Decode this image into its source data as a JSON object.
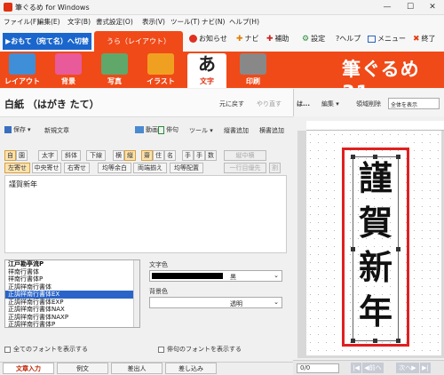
{
  "window": {
    "title": "筆ぐるめ for Windows"
  },
  "menubar": [
    "ファイル(F)",
    "編集(E)",
    "文字(B)",
    "書式設定(O)",
    "表示(V)",
    "ツール(T)",
    "ナビ(N)",
    "ヘルプ(H)"
  ],
  "tabs": {
    "front": "▶おもて（宛て名）へ切替",
    "back": "うら（レイアウト）"
  },
  "top_links": {
    "notice": "お知らせ",
    "navi": "ナビ",
    "assist": "補助",
    "settings": "設定",
    "help": "?ヘルプ",
    "menu": "メニュー",
    "exit": "終了"
  },
  "main_toolbar": [
    {
      "label": "レイアウト",
      "color": "#3f8fd8"
    },
    {
      "label": "背景",
      "color": "#e85a9a"
    },
    {
      "label": "写真",
      "color": "#5fa86a"
    },
    {
      "label": "イラスト",
      "color": "#f0a020"
    },
    {
      "label": "文字",
      "color": "#ffffff"
    },
    {
      "label": "印刷",
      "color": "#888888"
    }
  ],
  "brand": "筆ぐるめ31",
  "panel": {
    "title": "白紙 （はがき たて）",
    "undo": "元に戻す",
    "redo": "やり直す",
    "save": "保存",
    "new_text": "新規文章",
    "video": "動画",
    "haiku": "俳句",
    "tool": "ツール",
    "add_vertical": "縦書追加",
    "add_horizontal": "横書追加"
  },
  "format_row1": [
    "自",
    "園",
    "太字",
    "斜体",
    "下線",
    "横",
    "縦",
    "齋",
    "住",
    "名",
    "手",
    "手",
    "数",
    "縦中横"
  ],
  "format_row2": [
    "左寄せ",
    "中央寄せ",
    "右寄せ",
    "均等余白",
    "両端揃え",
    "均等配置",
    "一行目優先",
    "割"
  ],
  "text_content": "謹賀新年",
  "fonts": [
    "江戸勘亭流P",
    "祥南行書体",
    "祥南行書体P",
    "正調祥南行書体",
    "正調祥南行書体EX",
    "正調祥南行書体EXP",
    "正調祥南行書体NAX",
    "正調祥南行書体NAXP",
    "正調祥南行書体P"
  ],
  "selected_font_index": 4,
  "text_color": {
    "label": "文字色",
    "value": "黒"
  },
  "bg_color": {
    "label": "背景色",
    "value": "透明"
  },
  "show_all_fonts": "全てのフォントを表示する",
  "show_haiku_fonts": "俳句のフォントを表示する",
  "bottom_tabs": [
    "文章入力",
    "例文",
    "差出人",
    "差し込み"
  ],
  "right_panel": {
    "label": "は...",
    "edit": "編集",
    "delete_area": "領域削除",
    "view_select": "全体を表示",
    "characters": [
      "謹",
      "賀",
      "新",
      "年"
    ],
    "page": "0/0",
    "first": "|◀",
    "prev": "◀前へ",
    "next": "次へ▶",
    "last": "▶|"
  }
}
